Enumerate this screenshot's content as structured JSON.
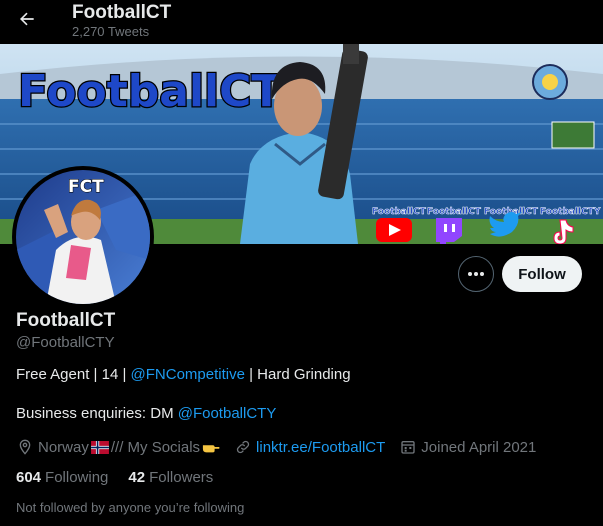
{
  "header": {
    "title": "FootballCT",
    "tweet_count": "2,270 Tweets"
  },
  "banner": {
    "wordmark": "FootballCT",
    "social_labels": [
      "FootballCT",
      "FootballCT",
      "FootballCT",
      "FootballCTY"
    ],
    "social_icons": [
      "youtube-icon",
      "twitch-icon",
      "twitter-icon",
      "tiktok-icon"
    ]
  },
  "avatar": {
    "label": "FCT"
  },
  "actions": {
    "more_label": "•••",
    "follow_label": "Follow"
  },
  "profile": {
    "display_name": "FootballCT",
    "handle": "@FootballCTY",
    "bio_line1_a": "Free Agent | 14 | ",
    "bio_line1_mention": "@FNCompetitive",
    "bio_line1_b": " | Hard Grinding",
    "bio_line2_a": "Business enquiries: DM ",
    "bio_line2_mention": "@FootballCTY",
    "location": "Norway",
    "location_extra": " /// My Socials",
    "website": "linktr.ee/FootballCT",
    "joined": "Joined April 2021"
  },
  "stats": {
    "following_count": "604",
    "following_label": "Following",
    "followers_count": "42",
    "followers_label": "Followers"
  },
  "footer": {
    "not_followed": "Not followed by anyone you’re following"
  },
  "colors": {
    "background": "#000000",
    "link": "#1d9bf0",
    "muted": "#71767b",
    "text": "#e7e9ea",
    "follow_bg": "#eff3f4"
  }
}
